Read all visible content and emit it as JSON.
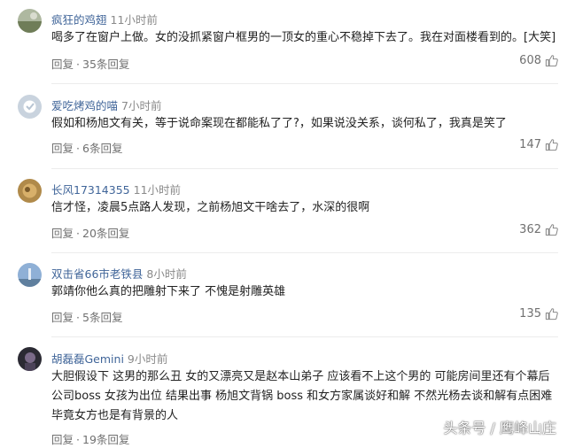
{
  "comments": [
    {
      "username": "疯狂的鸡翅",
      "time": "11小时前",
      "lines": [
        "喝多了在窗户上做。女的没抓紧窗户框男的一顶女的重心不稳掉下去了。我在对面楼看到的。[大笑]"
      ],
      "reply_label": "回复",
      "replies": "35条回复",
      "likes": "608"
    },
    {
      "username": "爱吃烤鸡的喵",
      "time": "7小时前",
      "lines": [
        "假如和杨旭文有关，等于说命案现在都能私了了?，如果说没关系，谈何私了，我真是笑了"
      ],
      "reply_label": "回复",
      "replies": "6条回复",
      "likes": "147"
    },
    {
      "username": "长风17314355",
      "time": "11小时前",
      "lines": [
        "信才怪，凌晨5点路人发现，之前杨旭文干啥去了，水深的很啊"
      ],
      "reply_label": "回复",
      "replies": "20条回复",
      "likes": "362"
    },
    {
      "username": "双击省66市老铁县",
      "time": "8小时前",
      "lines": [
        "郭靖你他么真的把雕射下来了 不愧是射雕英雄"
      ],
      "reply_label": "回复",
      "replies": "5条回复",
      "likes": "135"
    },
    {
      "username": "胡磊磊Gemini",
      "time": "9小时前",
      "lines": [
        "大胆假设下 这男的那么丑 女的又漂亮又是赵本山弟子 应该看不上这个男的 可能房间里还有个幕后",
        "公司boss 女孩为出位 结果出事 杨旭文背锅 boss 和女方家属谈好和解 不然光杨去谈和解有点困难",
        "毕竟女方也是有背景的人"
      ],
      "reply_label": "回复",
      "replies": "19条回复",
      "likes": ""
    }
  ],
  "separator": "·",
  "watermark": "头条号 / 鹰峰山庄",
  "colors": {
    "username": "#406599",
    "time": "#8a8a8a",
    "meta": "#707070",
    "divider": "#ececec"
  },
  "icons": {
    "like": "thumbs-up-icon"
  }
}
